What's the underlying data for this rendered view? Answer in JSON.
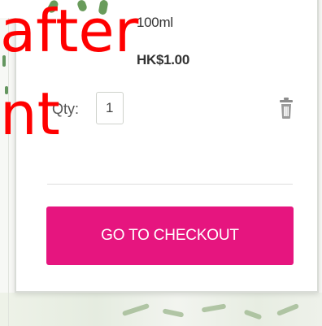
{
  "product": {
    "size": "100ml",
    "price": "HK$1.00"
  },
  "quantity": {
    "label": "Qty:",
    "value": "1"
  },
  "actions": {
    "remove_icon": "trash-icon",
    "checkout_label": "GO TO CHECKOUT"
  },
  "overlay": {
    "line1": "after",
    "line2": "nt"
  },
  "colors": {
    "checkout_button": "#e6157f",
    "overlay_text": "#ff0000",
    "text": "#333333"
  }
}
